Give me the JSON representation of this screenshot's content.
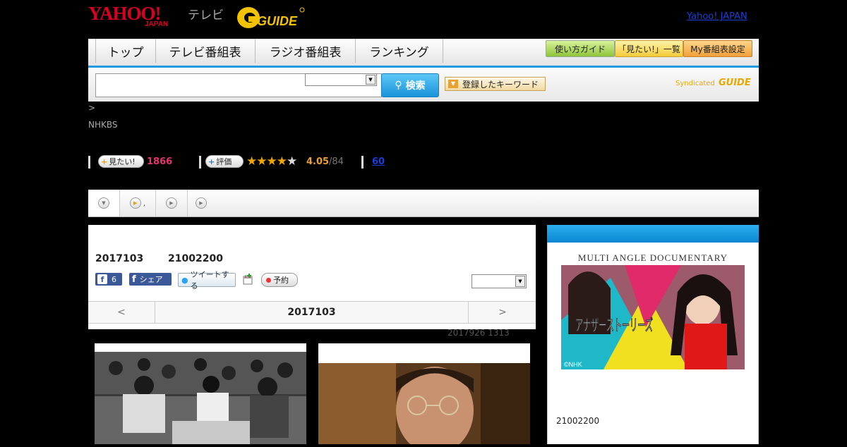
{
  "header": {
    "logo_yahoo": "YAHOO!",
    "logo_japan": "JAPAN",
    "tv_label": "テレビ",
    "gguide_label": "GUIDE",
    "yahoo_japan_link": "Yahoo! JAPAN"
  },
  "nav": {
    "tabs": [
      "トップ",
      "テレビ番組表",
      "ラジオ番組表",
      "ランキング"
    ],
    "buttons": [
      "使い方ガイド",
      "「見たい!」一覧",
      "My番組表設定"
    ]
  },
  "search": {
    "input_value": "",
    "select_value": "",
    "button_label": "検索",
    "keyword_button": "登録したキーワード",
    "syndicated_label": "Syndicated"
  },
  "breadcrumb": ">",
  "channel": "NHKBS",
  "stats": {
    "want_label": "見たい!",
    "want_count": "1866",
    "rating_label": "評価",
    "rating_stars": 4,
    "rating_value": "4.05",
    "rating_count": "/84",
    "review_count": "60"
  },
  "subtabs": [
    ",",
    ""
  ],
  "program": {
    "date": "2017103",
    "time": "21002200",
    "fb_count": "6",
    "share_label": "シェア",
    "tweet_label": "ツイートする",
    "reserve_label": "予約",
    "select_value": "",
    "date_nav_prev": "<",
    "date_nav_current": "2017103",
    "date_nav_next": ">",
    "meta_line": "2017926  1313"
  },
  "sidebar": {
    "promo_title": "MULTI ANGLE DOCUMENTARY",
    "promo_name": "アナザーストーリーズ",
    "promo_credit": "©NHK",
    "caption": "21002200"
  }
}
